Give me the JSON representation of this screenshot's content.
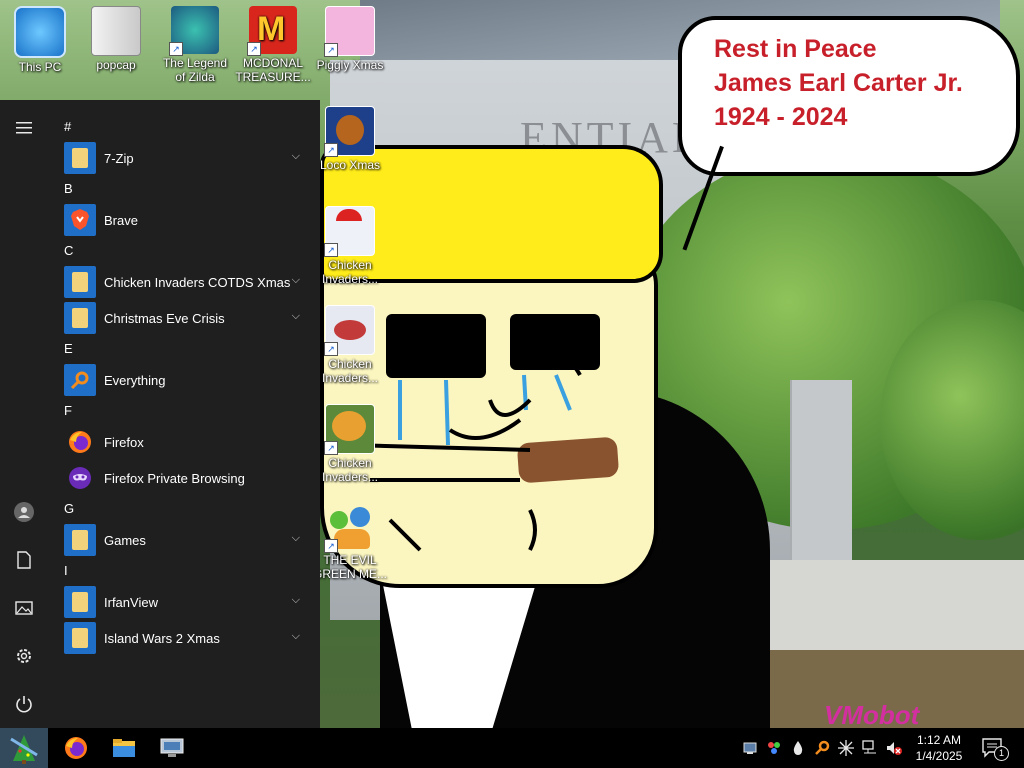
{
  "wallpaper": {
    "sign_text": "ENTIAL",
    "bubble_lines": [
      "Rest in Peace",
      "James Earl Carter Jr.",
      "1924 - 2024"
    ],
    "watermark": "VMobot"
  },
  "desktop_icons": [
    {
      "label": "This PC"
    },
    {
      "label": "popcap"
    },
    {
      "label": "The Legend of Zilda"
    },
    {
      "label": "MCDONAL TREASURE..."
    },
    {
      "label": "Piggly Xmas"
    },
    {
      "label": "Loco Xmas"
    },
    {
      "label": "Chicken Invaders..."
    },
    {
      "label": "Chicken Invaders..."
    },
    {
      "label": "Chicken Invaders..."
    },
    {
      "label": "THE EVIL GREEN ME..."
    }
  ],
  "start_menu": {
    "sections": [
      {
        "letter": "#",
        "apps": [
          {
            "name": "7-Zip",
            "icon": "folder-icon",
            "expandable": true
          }
        ]
      },
      {
        "letter": "B",
        "apps": [
          {
            "name": "Brave",
            "icon": "brave-icon",
            "expandable": false
          }
        ]
      },
      {
        "letter": "C",
        "apps": [
          {
            "name": "Chicken Invaders COTDS Xmas",
            "icon": "folder-icon",
            "expandable": true
          },
          {
            "name": "Christmas Eve Crisis",
            "icon": "folder-icon",
            "expandable": true
          }
        ]
      },
      {
        "letter": "E",
        "apps": [
          {
            "name": "Everything",
            "icon": "everything-icon",
            "expandable": false
          }
        ]
      },
      {
        "letter": "F",
        "apps": [
          {
            "name": "Firefox",
            "icon": "firefox-icon",
            "expandable": false
          },
          {
            "name": "Firefox Private Browsing",
            "icon": "firefox-private-icon",
            "expandable": false
          }
        ]
      },
      {
        "letter": "G",
        "apps": [
          {
            "name": "Games",
            "icon": "folder-icon",
            "expandable": true
          }
        ]
      },
      {
        "letter": "I",
        "apps": [
          {
            "name": "IrfanView",
            "icon": "folder-icon",
            "expandable": true
          },
          {
            "name": "Island Wars 2 Xmas",
            "icon": "folder-icon",
            "expandable": true
          }
        ]
      }
    ]
  },
  "taskbar": {
    "pinned": [
      "firefox-icon",
      "file-explorer-icon",
      "computer-icon"
    ],
    "tray_icons": [
      "display-icon",
      "network-share-icon",
      "droplet-icon",
      "everything-search-icon",
      "sparkle-icon",
      "network-icon",
      "volume-muted-icon"
    ],
    "time": "1:12 AM",
    "date": "1/4/2025",
    "notification_count": "1"
  },
  "colors": {
    "accent": "#1f6fc9",
    "menu_bg": "#1f1f1f",
    "taskbar_bg": "#000000",
    "bubble_text": "#c8202a"
  }
}
